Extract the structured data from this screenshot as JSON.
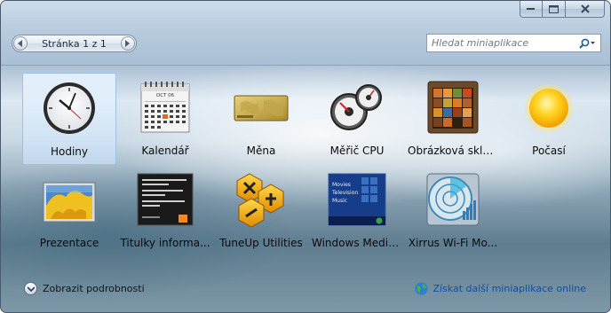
{
  "window": {
    "caption_buttons": [
      "minimize-icon",
      "maximize-icon",
      "close-icon"
    ]
  },
  "pager": {
    "label": "Stránka 1 z 1",
    "prev_icon": "chevron-left-icon",
    "next_icon": "chevron-right-icon"
  },
  "search": {
    "placeholder": "Hledat miniaplikace",
    "icon": "search-icon"
  },
  "gadgets": [
    {
      "label": "Hodiny",
      "icon": "clock-icon",
      "selected": true
    },
    {
      "label": "Kalendář",
      "icon": "calendar-icon",
      "calendar_month": "OCT 06"
    },
    {
      "label": "Měna",
      "icon": "currency-icon"
    },
    {
      "label": "Měřič CPU",
      "icon": "cpu-meter-icon"
    },
    {
      "label": "Obrázková sklá...",
      "icon": "picture-puzzle-icon"
    },
    {
      "label": "Počasí",
      "icon": "weather-sun-icon"
    },
    {
      "label": "Prezentace",
      "icon": "slideshow-icon"
    },
    {
      "label": "Titulky informa...",
      "icon": "feed-headlines-icon"
    },
    {
      "label": "TuneUp Utilities",
      "icon": "tuneup-utilities-icon"
    },
    {
      "label": "Windows Media...",
      "icon": "media-center-icon",
      "menu": [
        "Movies",
        "Television",
        "Music"
      ]
    },
    {
      "label": "Xirrus Wi-Fi Mo...",
      "icon": "wifi-monitor-icon"
    }
  ],
  "footer": {
    "details_label": "Zobrazit podrobnosti",
    "online_link": "Získat další miniaplikace online"
  },
  "colors": {
    "link": "#0f4fa8",
    "selected_tile": "#c8def5"
  }
}
